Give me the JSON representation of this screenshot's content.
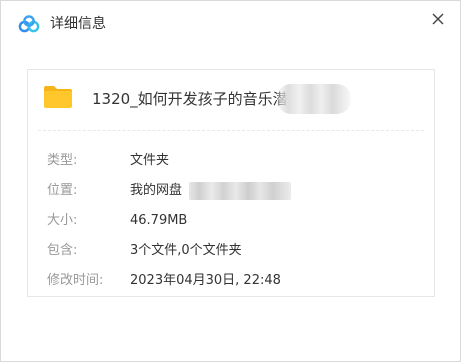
{
  "window": {
    "title": "详细信息",
    "close_symbol": "✕",
    "app_icon": "baidu-netdisk-logo-icon"
  },
  "file": {
    "name": "1320_如何开发孩子的音乐潜力",
    "icon": "folder-icon"
  },
  "details": {
    "type": {
      "label": "类型:",
      "value": "文件夹"
    },
    "location": {
      "label": "位置:",
      "value": "我的网盘"
    },
    "size": {
      "label": "大小:",
      "value": "46.79MB"
    },
    "contains": {
      "label": "包含:",
      "value": "3个文件,0个文件夹"
    },
    "modified": {
      "label": "修改时间:",
      "value": "2023年04月30日, 22:48"
    }
  },
  "colors": {
    "folder": "#FFC72C",
    "label_text": "#999999",
    "value_text": "#333333",
    "logo_blue": "#2F8CF0",
    "logo_cyan": "#36C3E8"
  }
}
